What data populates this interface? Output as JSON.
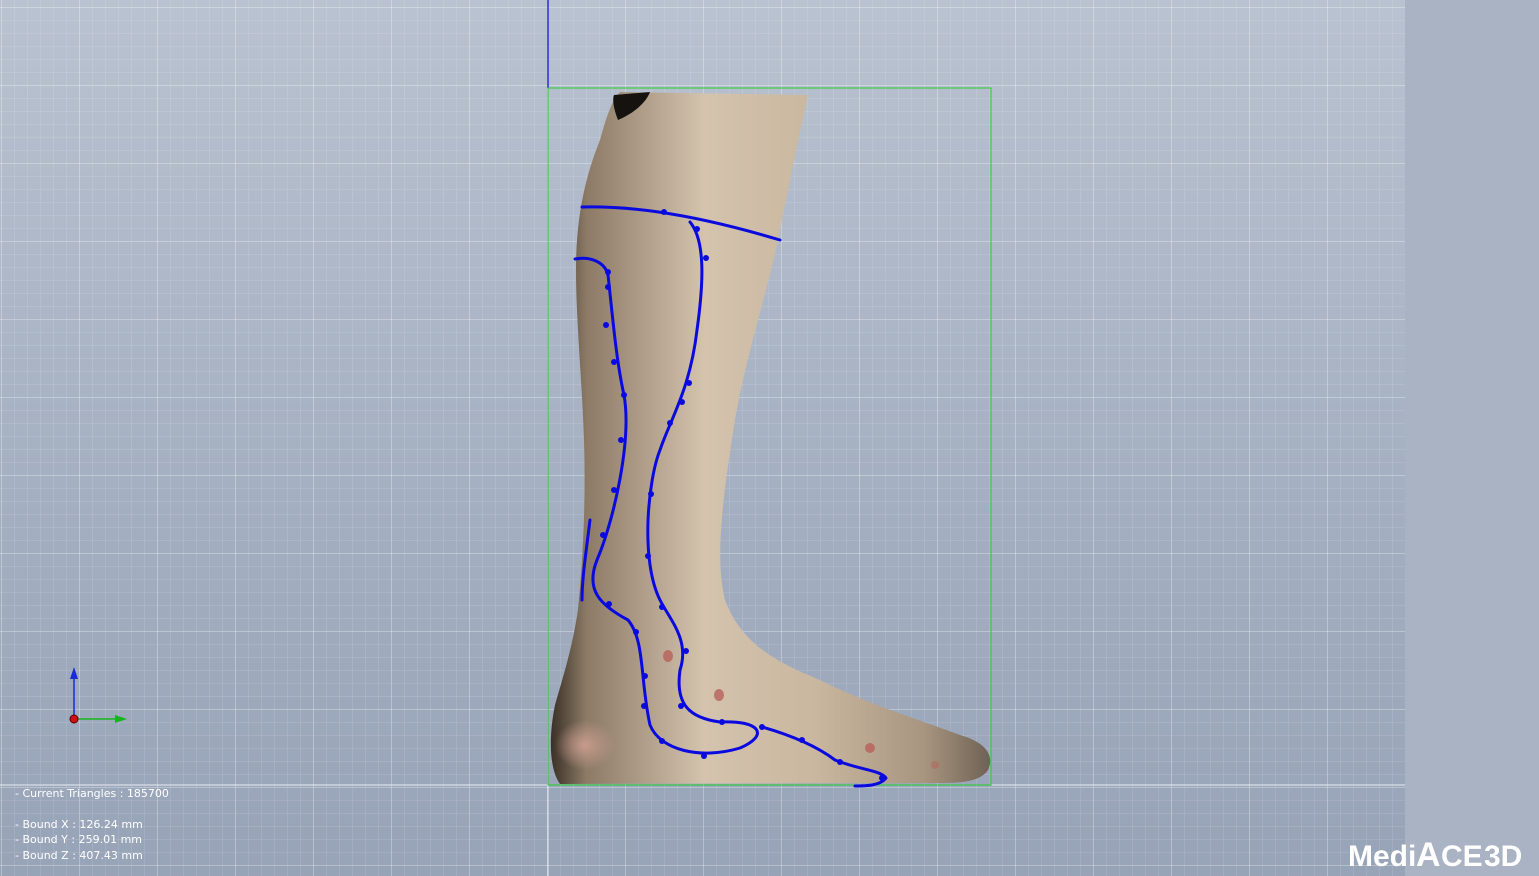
{
  "viewport": {
    "background": "#a9b4c5",
    "colors": {
      "bounding_box": "#27d12a",
      "vertical_axis": "#2a2ad8",
      "trim_curves": "#0a0ae0",
      "axis_x": "#17b51d",
      "axis_y": "#1a2ad8",
      "axis_origin": "#d01010"
    }
  },
  "model": {
    "icon": "leg-foot-scan-model"
  },
  "triad": {
    "icon": "xyz-axis-triad-icon"
  },
  "info": {
    "triangles": "- Current Triangles : 185700",
    "bound_x": "- Bound X : 126.24 mm",
    "bound_y": "- Bound Y : 259.01 mm",
    "bound_z": "- Bound Z : 407.43 mm"
  },
  "logo": {
    "text_medi": "Medi",
    "text_a": "A",
    "text_ce": "CE",
    "text_3d": "3D",
    "color": "#ffffff"
  }
}
